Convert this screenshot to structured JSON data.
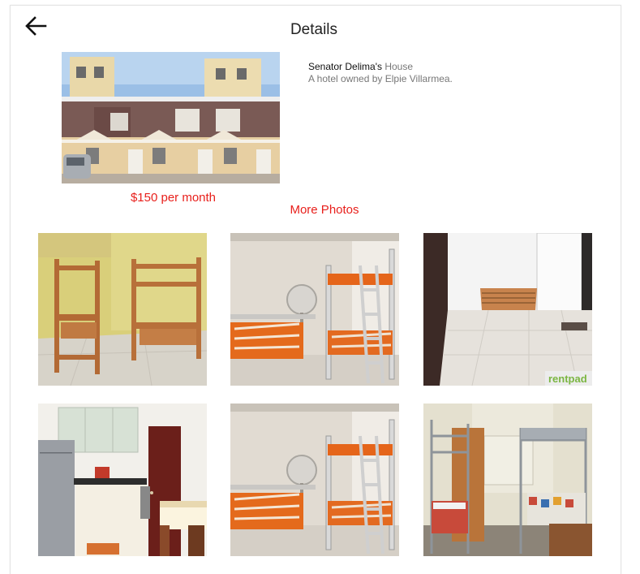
{
  "header": {
    "title": "Details",
    "back_icon": "arrow-left-icon"
  },
  "listing": {
    "name_bold": "Senator Delima's",
    "name_suffix": "House",
    "description": "A hotel owned by Elpie Villarmea.",
    "price": "$150 per month",
    "more_photos_label": "More Photos"
  },
  "gallery": {
    "watermark": "rentpad",
    "photos": [
      {
        "subject": "wooden-bunk-beds-room"
      },
      {
        "subject": "metal-bunk-bed-with-fan"
      },
      {
        "subject": "empty-room-bed-frame"
      },
      {
        "subject": "kitchen-with-fridge"
      },
      {
        "subject": "metal-bunk-bed-with-fan"
      },
      {
        "subject": "dorm-room-metal-bunks"
      }
    ]
  },
  "colors": {
    "accent": "#e8201c",
    "text": "#222222",
    "muted": "#777777"
  }
}
